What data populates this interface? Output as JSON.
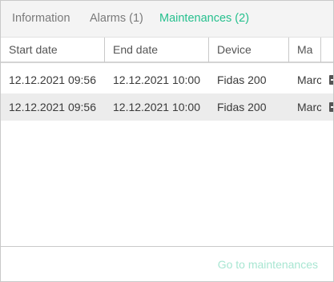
{
  "tabs": [
    {
      "label": "Information"
    },
    {
      "label": "Alarms (1)"
    },
    {
      "label": "Maintenances (2)"
    }
  ],
  "active_tab": "Maintenances (2)",
  "accent_color": "#26c08e",
  "table": {
    "columns": [
      {
        "label": "Start date"
      },
      {
        "label": "End date"
      },
      {
        "label": "Device"
      },
      {
        "label": "Ma"
      }
    ],
    "rows": [
      {
        "start": "12.12.2021 09:56",
        "end": "12.12.2021 10:00",
        "device": "Fidas 200",
        "ma": "Marc"
      },
      {
        "start": "12.12.2021 09:56",
        "end": "12.12.2021 10:00",
        "device": "Fidas 200",
        "ma": "Marc"
      }
    ]
  },
  "footer": {
    "link_label": "Go to maintenances"
  }
}
